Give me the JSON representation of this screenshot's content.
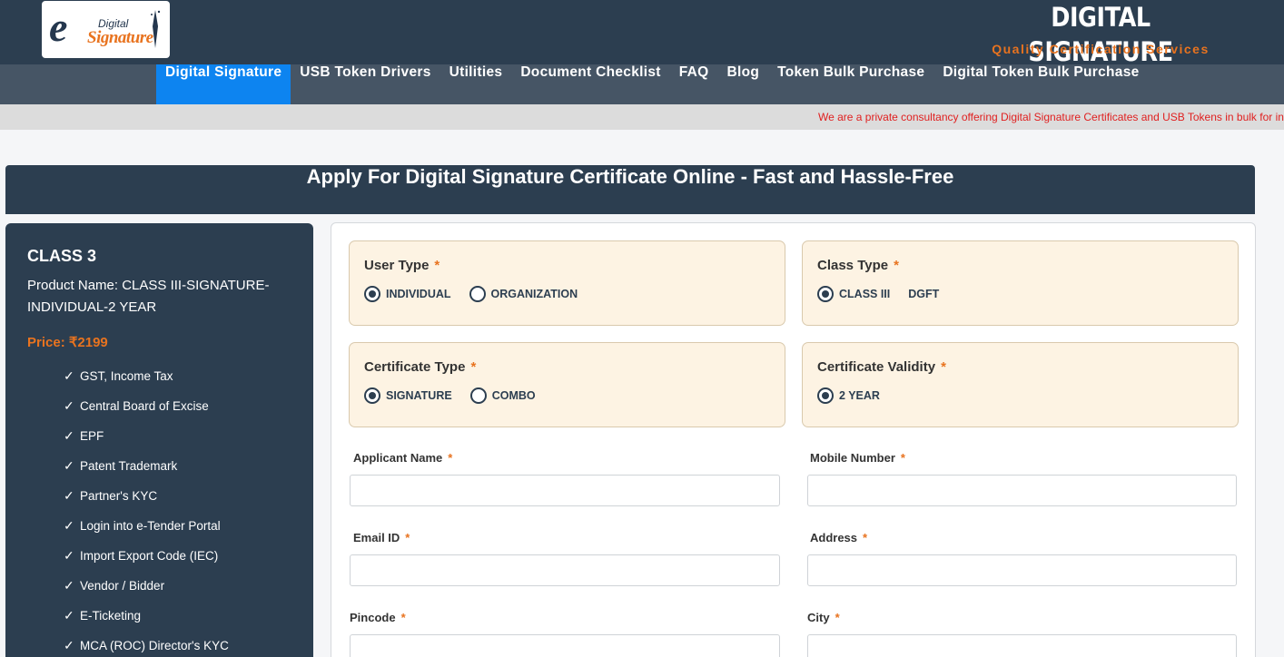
{
  "header": {
    "logo": {
      "e": "e",
      "digital": "Digital",
      "signature": "Signature"
    },
    "brand_title": "DIGITAL SIGNATURE",
    "brand_subtitle": "Quality Certification Services"
  },
  "nav": {
    "items": [
      {
        "label": "Digital Signature",
        "active": true
      },
      {
        "label": "USB Token Drivers"
      },
      {
        "label": "Utilities"
      },
      {
        "label": "Document Checklist"
      },
      {
        "label": "FAQ"
      },
      {
        "label": "Blog"
      },
      {
        "label": "Token Bulk Purchase"
      },
      {
        "label": "Digital Token Bulk Purchase"
      }
    ]
  },
  "ticker": {
    "text": "We are a private consultancy offering Digital Signature Certificates and USB Tokens in bulk for individuals"
  },
  "page_title": "Apply For Digital Signature Certificate Online - Fast and Hassle-Free",
  "product": {
    "class": "CLASS 3",
    "name": "Product Name: CLASS III-SIGNATURE-INDIVIDUAL-2 YEAR",
    "price_label": "Price: ₹2199",
    "tick": "✓",
    "features": [
      "GST, Income Tax",
      "Central Board of Excise",
      "EPF",
      "Patent Trademark",
      "Partner's KYC",
      "Login into e-Tender Portal",
      "Import Export Code (IEC)",
      "Vendor / Bidder",
      "E-Ticketing",
      "MCA (ROC) Director's KYC"
    ]
  },
  "form": {
    "required_mark": "*",
    "user_type": {
      "title": "User Type",
      "options": [
        "INDIVIDUAL",
        "ORGANIZATION"
      ],
      "selected": "INDIVIDUAL"
    },
    "class_type": {
      "title": "Class Type",
      "options": [
        "CLASS III",
        "DGFT"
      ],
      "selected": "CLASS III"
    },
    "certificate_type": {
      "title": "Certificate Type",
      "options": [
        "SIGNATURE",
        "COMBO"
      ],
      "selected": "SIGNATURE"
    },
    "certificate_validity": {
      "title": "Certificate Validity",
      "options": [
        "2 YEAR"
      ],
      "selected": "2 YEAR"
    },
    "fields": {
      "applicant_name": {
        "label": "Applicant Name",
        "value": ""
      },
      "mobile_number": {
        "label": "Mobile Number",
        "value": ""
      },
      "email_id": {
        "label": "Email ID",
        "value": ""
      },
      "address": {
        "label": "Address",
        "value": ""
      },
      "pincode": {
        "label": "Pincode",
        "value": ""
      },
      "city": {
        "label": "City",
        "value": ""
      }
    }
  },
  "colors": {
    "header_bg": "#2c3e50",
    "nav_bg": "#465565",
    "nav_active": "#0d84f0",
    "accent": "#e8731f",
    "ticker_text": "#e02020",
    "option_box_bg": "#fdf3e3"
  }
}
